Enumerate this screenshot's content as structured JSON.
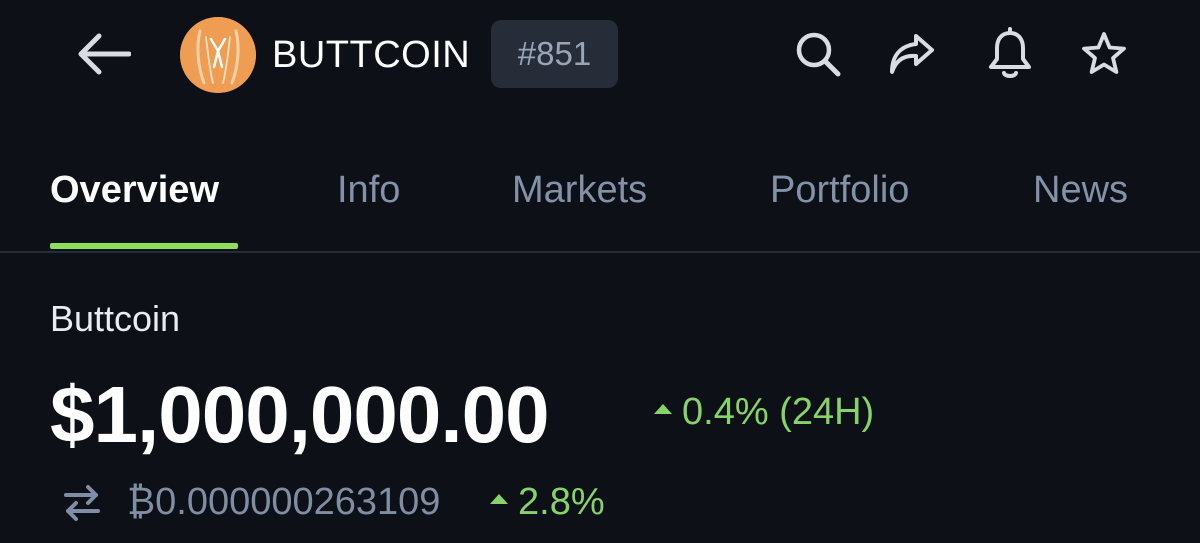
{
  "header": {
    "back_icon": "arrow-left-icon",
    "coin_symbol": "BUTTCOIN",
    "rank": "#851",
    "actions": {
      "search_icon": "search-icon",
      "share_icon": "share-icon",
      "bell_icon": "bell-icon",
      "star_icon": "star-icon"
    }
  },
  "tabs": [
    {
      "label": "Overview",
      "active": true
    },
    {
      "label": "Info",
      "active": false
    },
    {
      "label": "Markets",
      "active": false
    },
    {
      "label": "Portfolio",
      "active": false
    },
    {
      "label": "News",
      "active": false
    }
  ],
  "overview": {
    "coin_name": "Buttcoin",
    "price": "$1,000,000.00",
    "change_24h": "0.4% (24H)",
    "change_24h_direction": "up",
    "btc_price": "₿0.000000263109",
    "btc_change": "2.8%",
    "btc_change_direction": "up",
    "swap_icon": "swap-arrows-icon"
  },
  "colors": {
    "background": "#0d1016",
    "accent_green": "#8edc5b",
    "positive": "#86d369",
    "muted_text": "#8392a8",
    "badge_bg": "#262d38",
    "logo_orange": "#ee9d52"
  }
}
